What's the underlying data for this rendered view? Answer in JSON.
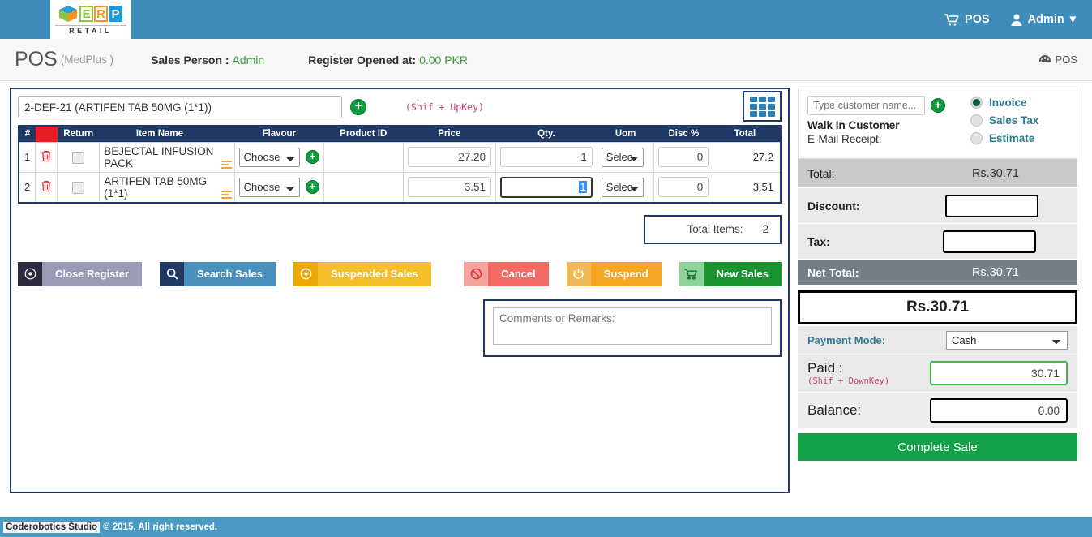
{
  "topnav": {
    "logo": {
      "letters": [
        "E",
        "R",
        "P"
      ],
      "subtitle": "RETAIL",
      "cube_icon": "cube-icon"
    },
    "items": [
      {
        "label": "POS",
        "icon": "shopping-cart-icon"
      },
      {
        "label": "Admin",
        "icon": "user-icon",
        "caret": "▾"
      }
    ]
  },
  "subheader": {
    "title": "POS",
    "subtitle": "(MedPlus  )",
    "sales_person_label": "Sales Person :",
    "sales_person_value": "Admin",
    "register_label": "Register Opened at:",
    "register_value": "0.00 PKR",
    "right_link": "POS"
  },
  "search": {
    "value": "2-DEF-21 (ARTIFEN TAB 50MG (1*1))",
    "placeholder": "",
    "add_icon": "plus-circle-icon",
    "hint": "(Shif + UpKey)",
    "grid_icon": "grid-icon"
  },
  "table": {
    "headers": [
      "#",
      "",
      "Return",
      "Item Name",
      "Flavour",
      "Product ID",
      "Price",
      "Qty.",
      "Uom",
      "Disc %",
      "Total"
    ],
    "rows": [
      {
        "num": "1",
        "delete_icon": "trash-icon",
        "return_checked": false,
        "item_name": "BEJECTAL INFUSION PACK",
        "list_icon": "list-lines-icon",
        "flavour": "Choose",
        "flavour_add_icon": "plus-circle-icon",
        "product_id": "",
        "price": "27.20",
        "qty": "1",
        "uom": "Selec",
        "disc": "0",
        "total": "27.2"
      },
      {
        "num": "2",
        "delete_icon": "trash-icon",
        "return_checked": false,
        "item_name": "ARTIFEN TAB 50MG (1*1)",
        "list_icon": "list-lines-icon",
        "flavour": "Choose",
        "flavour_add_icon": "plus-circle-icon",
        "product_id": "",
        "price": "3.51",
        "qty": "1",
        "uom": "Selec",
        "disc": "0",
        "total": "3.51"
      }
    ],
    "total_items_label": "Total Items:",
    "total_items_value": "2"
  },
  "buttons": {
    "close_register": {
      "label": "Close Register",
      "icon": "close-register-icon"
    },
    "search_sales": {
      "label": "Search Sales",
      "icon": "search-icon"
    },
    "suspended_sales": {
      "label": "Suspended Sales",
      "icon": "suspended-icon"
    },
    "cancel": {
      "label": "Cancel",
      "icon": "ban-icon"
    },
    "suspend": {
      "label": "Suspend",
      "icon": "power-icon"
    },
    "new_sales": {
      "label": "New Sales",
      "icon": "shopping-cart-icon"
    }
  },
  "comments": {
    "placeholder": "Comments or Remarks:",
    "value": ""
  },
  "customer": {
    "input_placeholder": "Type customer name...",
    "input_value": "",
    "add_icon": "plus-circle-icon",
    "walk_in": "Walk In Customer",
    "email_label": "E-Mail Receipt:",
    "options": [
      {
        "label": "Invoice",
        "selected": true
      },
      {
        "label": "Sales Tax",
        "selected": false
      },
      {
        "label": "Estimate",
        "selected": false
      }
    ]
  },
  "totals": {
    "total_label": "Total:",
    "total_value": "Rs.30.71",
    "discount_label": "Discount:",
    "discount_value": "",
    "tax_label": "Tax:",
    "tax_value": "",
    "net_total_label": "Net Total:",
    "net_total_value": "Rs.30.71",
    "big_total": "Rs.30.71"
  },
  "payment": {
    "mode_label": "Payment Mode:",
    "mode_value": "Cash",
    "mode_options": [
      "Cash"
    ],
    "paid_label": "Paid :",
    "paid_hint": "(Shif + DownKey)",
    "paid_value": "30.71",
    "balance_label": "Balance:",
    "balance_value": "0.00",
    "complete_label": "Complete Sale"
  },
  "footer": {
    "link": "Coderobotics Studio",
    "text": "© 2015. All right reserved."
  },
  "colors": {
    "nav_blue": "#3f8dba",
    "panel_border": "#1f3864",
    "accent_green": "#13a048",
    "hint_red": "#c9426b",
    "header_red": "#ec1c24"
  }
}
